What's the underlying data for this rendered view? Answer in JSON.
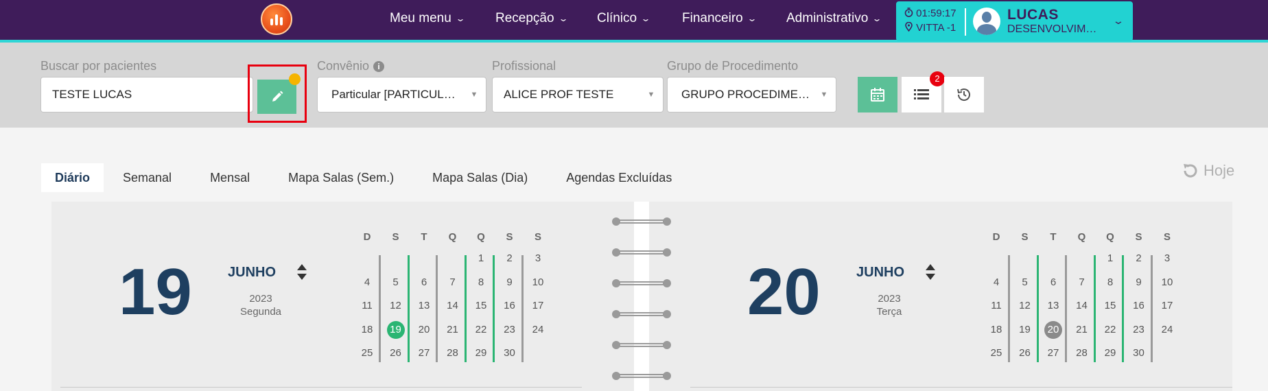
{
  "nav": {
    "items": [
      {
        "label": "Meu menu"
      },
      {
        "label": "Recepção"
      },
      {
        "label": "Clínico"
      },
      {
        "label": "Financeiro"
      },
      {
        "label": "Administrativo"
      }
    ]
  },
  "user": {
    "timer": "01:59:17",
    "location": "VITTA -1",
    "name": "LUCAS",
    "role": "DESENVOLVIMENTO"
  },
  "filters": {
    "patient_label": "Buscar por pacientes",
    "patient_value": "TESTE LUCAS",
    "convenio_label": "Convênio",
    "convenio_value": "Particular [PARTICULAR]",
    "profissional_label": "Profissional",
    "profissional_value": "ALICE PROF TESTE",
    "grupo_label": "Grupo de Procedimento",
    "grupo_value": "GRUPO PROCEDIMENTO",
    "list_badge": "2"
  },
  "tabs": [
    {
      "label": "Diário"
    },
    {
      "label": "Semanal"
    },
    {
      "label": "Mensal"
    },
    {
      "label": "Mapa Salas (Sem.)"
    },
    {
      "label": "Mapa Salas (Dia)"
    },
    {
      "label": "Agendas Excluídas"
    }
  ],
  "today_label": "Hoje",
  "weekday_headers": [
    "D",
    "S",
    "T",
    "Q",
    "Q",
    "S",
    "S"
  ],
  "calendars": [
    {
      "day": "19",
      "month": "JUNHO",
      "year": "2023",
      "weekday": "Segunda",
      "selected": 19,
      "selected_style": "green"
    },
    {
      "day": "20",
      "month": "JUNHO",
      "year": "2023",
      "weekday": "Terça",
      "selected": 20,
      "selected_style": "grey"
    }
  ],
  "month_grid": [
    [
      "",
      "",
      "",
      "",
      "1",
      "2",
      "3"
    ],
    [
      "4",
      "5",
      "6",
      "7",
      "8",
      "9",
      "10"
    ],
    [
      "11",
      "12",
      "13",
      "14",
      "15",
      "16",
      "17"
    ],
    [
      "18",
      "19",
      "20",
      "21",
      "22",
      "23",
      "24"
    ],
    [
      "25",
      "26",
      "27",
      "28",
      "29",
      "30",
      ""
    ]
  ],
  "colors": {
    "nav_bg": "#3f1c5a",
    "accent_cyan": "#22d2d2",
    "button_green": "#5cc097",
    "workday_bar": "#2bb573",
    "rest_bar": "#9a9a9a",
    "highlight_red": "#e8000f"
  }
}
